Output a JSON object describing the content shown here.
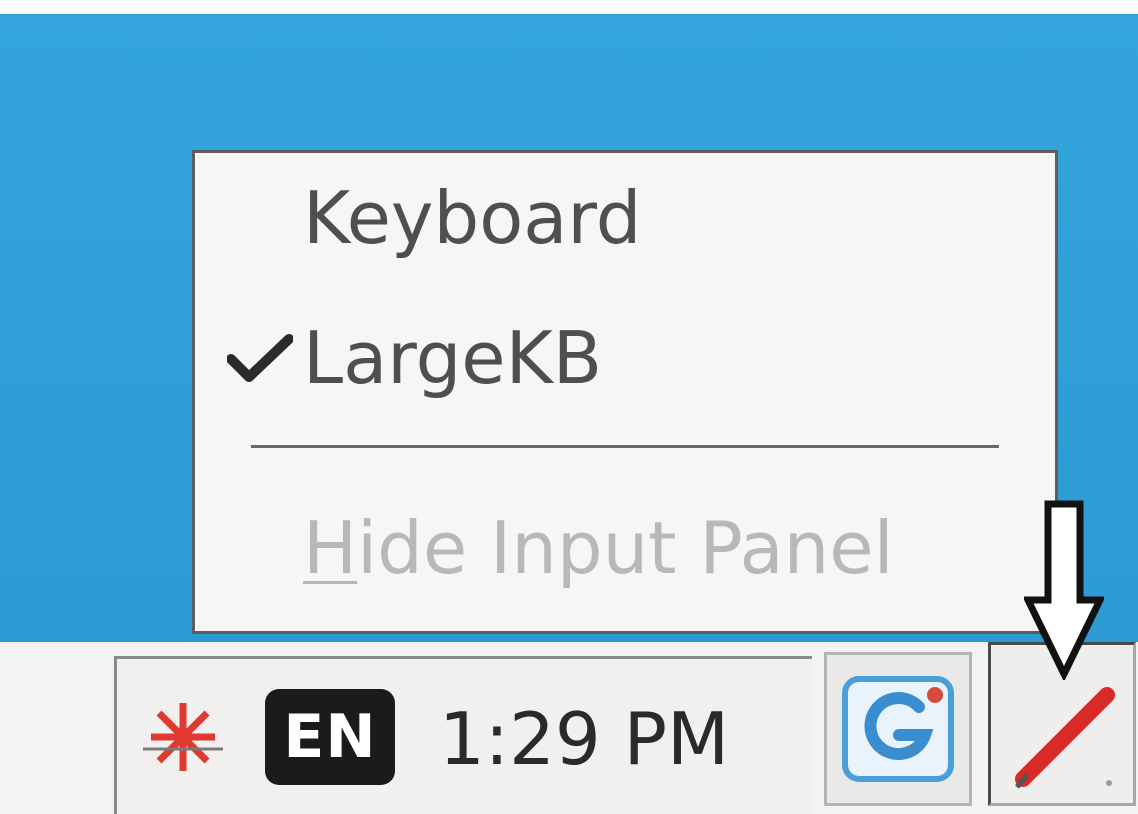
{
  "menu": {
    "items": [
      {
        "label": "Keyboard",
        "checked": false,
        "enabled": true
      },
      {
        "label": "LargeKB",
        "checked": true,
        "enabled": true
      },
      {
        "label": "Hide Input Panel",
        "mnemonic": "H",
        "label_rest": "ide Input Panel",
        "checked": false,
        "enabled": false
      }
    ]
  },
  "taskbar": {
    "tray": {
      "input_indicator_icon": "red-star-icon",
      "language": "EN",
      "clock": "1:29 PM"
    },
    "app_button_icon": "app-g-icon",
    "input_panel_button_icon": "pen-icon"
  },
  "annotation": {
    "icon": "down-arrow-icon"
  },
  "colors": {
    "desktop": "#33a4dc",
    "menu_bg": "#f7f6f4",
    "disabled_text": "#b8b8b8",
    "pen_red": "#d92a2a"
  }
}
